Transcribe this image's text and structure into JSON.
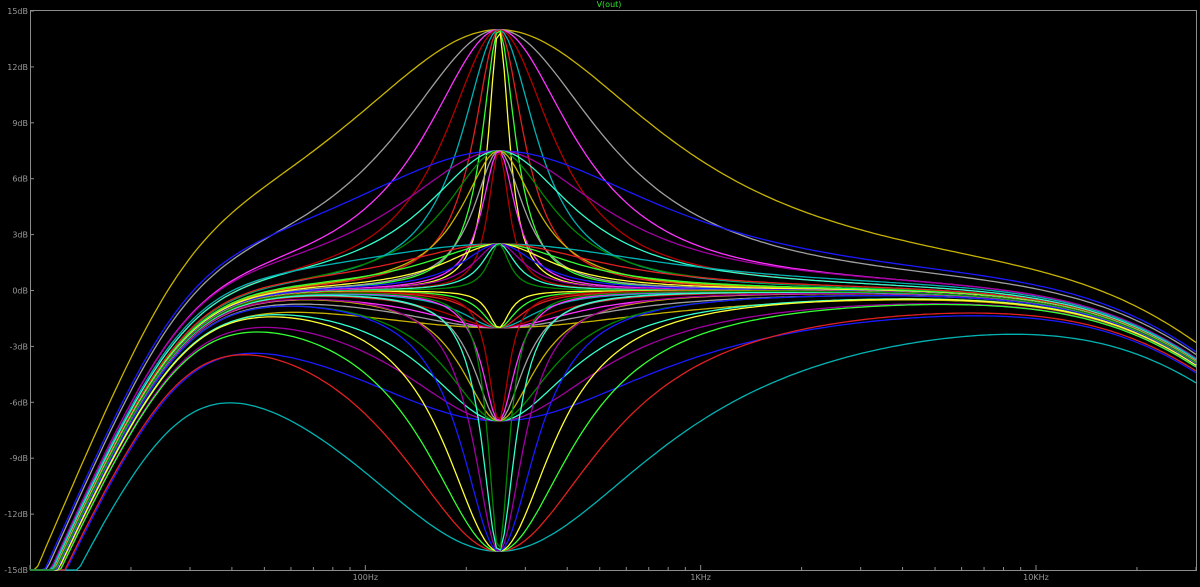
{
  "chart_data": {
    "type": "line",
    "title": "V(out)",
    "x_scale": "log",
    "xlim": [
      10,
      30000
    ],
    "ylim": [
      -15,
      15
    ],
    "x_ticks": [
      {
        "value": 100,
        "label": "100Hz"
      },
      {
        "value": 1000,
        "label": "1KHz"
      },
      {
        "value": 10000,
        "label": "10KHz"
      }
    ],
    "y_ticks": [
      {
        "value": 15,
        "label": "15dB"
      },
      {
        "value": 12,
        "label": "12dB"
      },
      {
        "value": 9,
        "label": "9dB"
      },
      {
        "value": 6,
        "label": "6dB"
      },
      {
        "value": 3,
        "label": "3dB"
      },
      {
        "value": 0,
        "label": "0dB"
      },
      {
        "value": -3,
        "label": "-3dB"
      },
      {
        "value": -6,
        "label": "-6dB"
      },
      {
        "value": -9,
        "label": "-9dB"
      },
      {
        "value": -12,
        "label": "-12dB"
      },
      {
        "value": -15,
        "label": "-15dB"
      }
    ],
    "grid": false,
    "center_freq_hz": 250,
    "gains_db": [
      14,
      7.5,
      2.5,
      -2,
      -7,
      -14
    ],
    "bandwidths_oct": [
      4.0,
      2.5,
      1.8,
      1.3,
      0.9,
      0.6,
      0.4,
      0.25
    ],
    "colors": [
      "#c8b400",
      "#a0a0a0",
      "#ff33ff",
      "#b20000",
      "#00b4b4",
      "#e02020",
      "#33ff33",
      "#ffff33",
      "#1a1aff",
      "#a000a0",
      "#33ffcc",
      "#008800"
    ],
    "series": [
      {
        "gain_db": 14,
        "bw_oct": 4.0,
        "values": [
          [
            10,
            -12.5
          ],
          [
            15,
            -7.3
          ],
          [
            20,
            -4.2
          ],
          [
            30,
            -0.7
          ],
          [
            50,
            2.5
          ],
          [
            100,
            7.5
          ],
          [
            150,
            11.6
          ],
          [
            250,
            14
          ],
          [
            400,
            11.6
          ],
          [
            700,
            5.3
          ],
          [
            1000,
            2.5
          ],
          [
            2000,
            0.8
          ],
          [
            5000,
            0.3
          ],
          [
            10000,
            0
          ],
          [
            30000,
            -0.6
          ]
        ]
      },
      {
        "gain_db": 14,
        "bw_oct": 1.8,
        "values": [
          [
            10,
            -12.5
          ],
          [
            20,
            -4.8
          ],
          [
            50,
            -0.3
          ],
          [
            100,
            1.7
          ],
          [
            150,
            5.0
          ],
          [
            200,
            10.5
          ],
          [
            250,
            14
          ],
          [
            300,
            11.5
          ],
          [
            500,
            3.0
          ],
          [
            1000,
            0.5
          ],
          [
            10000,
            0
          ],
          [
            30000,
            -0.6
          ]
        ]
      },
      {
        "gain_db": 7.5,
        "bw_oct": 4.0,
        "values": [
          [
            10,
            -12.5
          ],
          [
            20,
            -4.5
          ],
          [
            50,
            1.0
          ],
          [
            100,
            3.5
          ],
          [
            150,
            6.0
          ],
          [
            250,
            7.5
          ],
          [
            400,
            6.0
          ],
          [
            700,
            3.2
          ],
          [
            1000,
            1.8
          ],
          [
            3000,
            0.5
          ],
          [
            10000,
            0
          ],
          [
            30000,
            -0.6
          ]
        ]
      },
      {
        "gain_db": 2.5,
        "bw_oct": 2.5,
        "values": [
          [
            10,
            -12.5
          ],
          [
            20,
            -4.8
          ],
          [
            50,
            -0.5
          ],
          [
            100,
            0.8
          ],
          [
            250,
            2.5
          ],
          [
            600,
            0.9
          ],
          [
            1000,
            0.4
          ],
          [
            10000,
            0
          ],
          [
            30000,
            -0.6
          ]
        ]
      },
      {
        "gain_db": -2,
        "bw_oct": 4.0,
        "values": [
          [
            10,
            -12.5
          ],
          [
            20,
            -5.5
          ],
          [
            50,
            -1.0
          ],
          [
            100,
            -1.5
          ],
          [
            250,
            -2.0
          ],
          [
            600,
            -1.4
          ],
          [
            1000,
            -0.8
          ],
          [
            10000,
            0
          ],
          [
            30000,
            -0.6
          ]
        ]
      },
      {
        "gain_db": -7,
        "bw_oct": 4.0,
        "values": [
          [
            10,
            -12.5
          ],
          [
            20,
            -5.0
          ],
          [
            30,
            -2.2
          ],
          [
            50,
            -2.5
          ],
          [
            100,
            -4.5
          ],
          [
            250,
            -7.0
          ],
          [
            600,
            -5.0
          ],
          [
            1000,
            -3.5
          ],
          [
            3000,
            -1.0
          ],
          [
            10000,
            0
          ],
          [
            30000,
            -0.6
          ]
        ]
      },
      {
        "gain_db": -14,
        "bw_oct": 4.0,
        "values": [
          [
            10,
            -12.5
          ],
          [
            20,
            -4.0
          ],
          [
            30,
            -2.2
          ],
          [
            50,
            -3.5
          ],
          [
            100,
            -8.0
          ],
          [
            150,
            -11.5
          ],
          [
            250,
            -14
          ],
          [
            400,
            -11.5
          ],
          [
            700,
            -6.5
          ],
          [
            1000,
            -4.0
          ],
          [
            3000,
            -1.0
          ],
          [
            10000,
            0
          ],
          [
            30000,
            -0.6
          ]
        ]
      },
      {
        "gain_db": -14,
        "bw_oct": 0.6,
        "values": [
          [
            10,
            -12.5
          ],
          [
            50,
            -0.6
          ],
          [
            150,
            -1.5
          ],
          [
            200,
            -4.0
          ],
          [
            250,
            -14
          ],
          [
            300,
            -4.0
          ],
          [
            400,
            -1.2
          ],
          [
            1000,
            -0.2
          ],
          [
            10000,
            0
          ],
          [
            30000,
            -0.6
          ]
        ]
      }
    ]
  }
}
